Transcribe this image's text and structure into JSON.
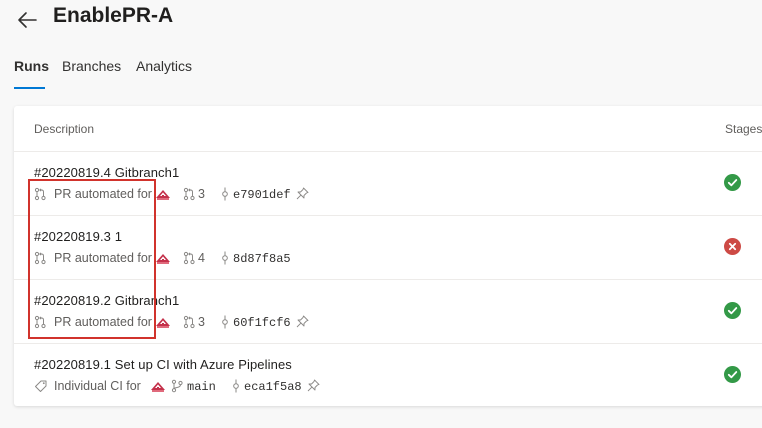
{
  "header": {
    "title": "EnablePR-A"
  },
  "tabs": [
    {
      "label": "Runs",
      "selected": true
    },
    {
      "label": "Branches"
    },
    {
      "label": "Analytics"
    }
  ],
  "table": {
    "columns": {
      "description": "Description",
      "stages": "Stages"
    },
    "rows": [
      {
        "title": "#20220819.4 Gitbranch1",
        "trigger_icon": "pull-request-icon",
        "trigger": "PR automated for",
        "ref_icon": "pull-request-icon",
        "ref": "3",
        "commit": "e7901def",
        "pinned": true,
        "status": "succeeded"
      },
      {
        "title": "#20220819.3 1",
        "trigger_icon": "pull-request-icon",
        "trigger": "PR automated for",
        "ref_icon": "pull-request-icon",
        "ref": "4",
        "commit": "8d87f8a5",
        "pinned": false,
        "status": "failed"
      },
      {
        "title": "#20220819.2 Gitbranch1",
        "trigger_icon": "pull-request-icon",
        "trigger": "PR automated for",
        "ref_icon": "pull-request-icon",
        "ref": "3",
        "commit": "60f1fcf6",
        "pinned": true,
        "status": "succeeded"
      },
      {
        "title": "#20220819.1 Set up CI with Azure Pipelines",
        "trigger_icon": "tag-icon",
        "trigger": "Individual CI for",
        "ref_icon": "branch-icon",
        "ref": "main",
        "commit": "eca1f5a8",
        "pinned": true,
        "status": "succeeded"
      }
    ]
  },
  "colors": {
    "accent": "#0078d4",
    "success": "#339947",
    "failure": "#cd4a45",
    "highlight": "#d1332c",
    "avatar": "#c4314b"
  }
}
